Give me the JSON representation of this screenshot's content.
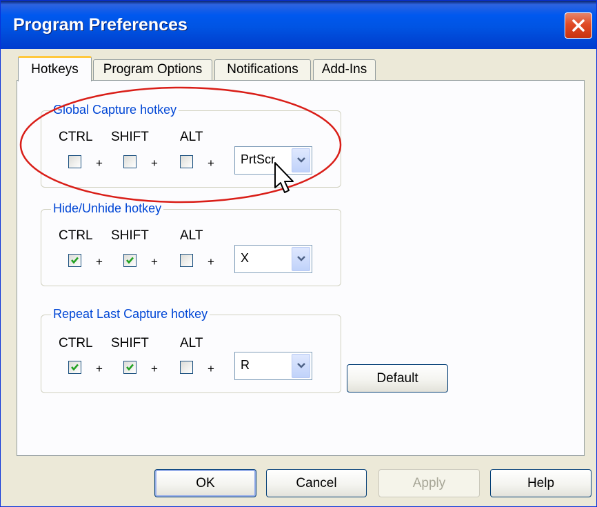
{
  "window": {
    "title": "Program Preferences"
  },
  "tabs": [
    {
      "label": "Hotkeys",
      "active": true
    },
    {
      "label": "Program Options",
      "active": false
    },
    {
      "label": "Notifications",
      "active": false
    },
    {
      "label": "Add-Ins",
      "active": false
    }
  ],
  "modifier_labels": {
    "ctrl": "CTRL",
    "shift": "SHIFT",
    "alt": "ALT"
  },
  "plus_sign": "+",
  "groups": [
    {
      "title": "Global Capture hotkey",
      "ctrl": false,
      "shift": false,
      "alt": false,
      "key": "PrtScr"
    },
    {
      "title": "Hide/Unhide hotkey",
      "ctrl": true,
      "shift": true,
      "alt": false,
      "key": "X"
    },
    {
      "title": "Repeat Last Capture hotkey",
      "ctrl": true,
      "shift": true,
      "alt": false,
      "key": "R"
    }
  ],
  "buttons": {
    "default": "Default",
    "ok": "OK",
    "cancel": "Cancel",
    "apply": "Apply",
    "help": "Help"
  },
  "colors": {
    "title_bar": "#0054e3",
    "group_title": "#0046d5",
    "annotation": "#d91e18",
    "check": "#21a121"
  }
}
